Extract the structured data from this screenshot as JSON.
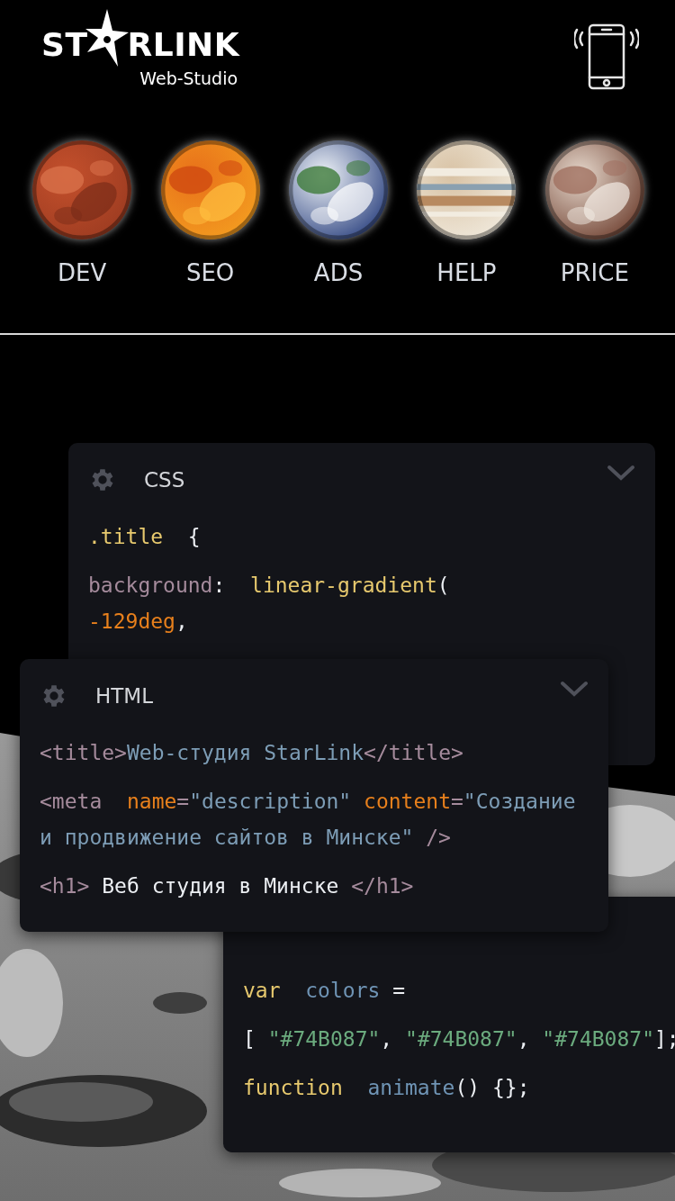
{
  "logo": {
    "left": "ST",
    "right": "RLINK",
    "subtitle": "Web-Studio"
  },
  "nav": [
    {
      "label": "DEV"
    },
    {
      "label": "SEO"
    },
    {
      "label": "ADS"
    },
    {
      "label": "HELP"
    },
    {
      "label": "PRICE"
    }
  ],
  "panels": [
    {
      "title": "CSS",
      "lines": [
        [
          [
            {
              "kind": "keyword",
              "text": ".title "
            },
            {
              "kind": "plain",
              "text": " {"
            }
          ]
        ],
        [
          [
            {
              "kind": "tag",
              "text": "background"
            },
            {
              "kind": "plain",
              "text": ":  "
            },
            {
              "kind": "keyword",
              "text": "linear-gradient"
            },
            {
              "kind": "plain",
              "text": "("
            }
          ],
          [
            {
              "kind": "number",
              "text": "-129deg"
            },
            {
              "kind": "plain",
              "text": ","
            }
          ]
        ]
      ]
    },
    {
      "title": "HTML",
      "lines": [
        [
          [
            {
              "kind": "tag",
              "text": "<title>"
            },
            {
              "kind": "text",
              "text": "Web-студия StarLink"
            },
            {
              "kind": "tag",
              "text": "</title>"
            }
          ]
        ],
        [
          [
            {
              "kind": "tag",
              "text": "<meta "
            },
            {
              "kind": "attr",
              "text": " name"
            },
            {
              "kind": "tag",
              "text": "="
            },
            {
              "kind": "text",
              "text": "\"description\""
            },
            {
              "kind": "attr",
              "text": " content"
            },
            {
              "kind": "tag",
              "text": "="
            },
            {
              "kind": "text",
              "text": "\"Создание"
            }
          ],
          [
            {
              "kind": "text",
              "text": "и продвижение сайтов в Минске\" "
            },
            {
              "kind": "tag",
              "text": "/>"
            }
          ]
        ],
        [
          [
            {
              "kind": "tag",
              "text": "<h1>"
            },
            {
              "kind": "plain",
              "text": " Веб студия в Минске "
            },
            {
              "kind": "tag",
              "text": "</h1>"
            }
          ]
        ]
      ]
    },
    {
      "lines": [
        [
          [
            {
              "kind": "keyword",
              "text": "var "
            },
            {
              "kind": "ident",
              "text": " colors"
            },
            {
              "kind": "plain",
              "text": " ="
            }
          ]
        ],
        [
          [
            {
              "kind": "plain",
              "text": "[ "
            },
            {
              "kind": "string",
              "text": "\"#74B087\""
            },
            {
              "kind": "plain",
              "text": ", "
            },
            {
              "kind": "string",
              "text": "\"#74B087\""
            },
            {
              "kind": "plain",
              "text": ", "
            },
            {
              "kind": "string",
              "text": "\"#74B087\""
            },
            {
              "kind": "plain",
              "text": "];"
            }
          ]
        ],
        [
          [
            {
              "kind": "keyword",
              "text": "function "
            },
            {
              "kind": "ident",
              "text": " animate"
            },
            {
              "kind": "plain",
              "text": "() {};"
            }
          ]
        ]
      ]
    }
  ]
}
